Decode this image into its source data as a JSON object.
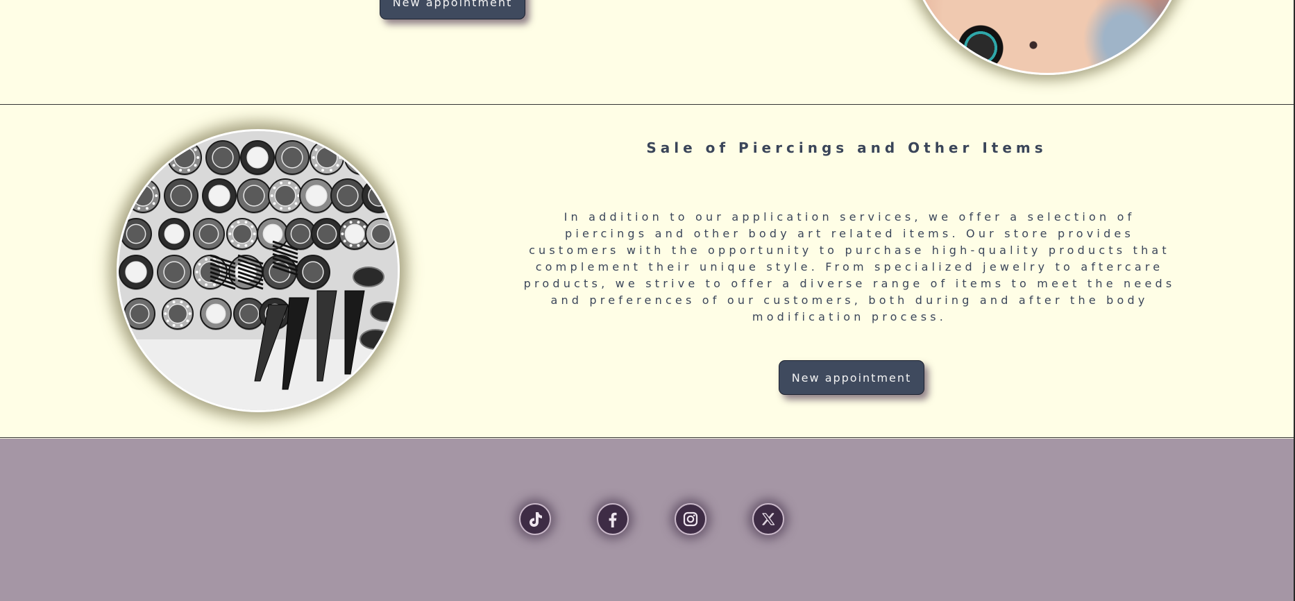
{
  "top_section": {
    "appointment_button_label": "New appointment"
  },
  "shop_section": {
    "title": "Sale of Piercings and Other Items",
    "description": "In addition to our application services, we offer a selection of piercings and other body art related items. Our store provides customers with the opportunity to purchase high-quality products that complement their unique style. From specialized jewelry to aftercare products, we strive to offer a diverse range of items to meet the needs and preferences of our customers, both during and after the body modification process.",
    "appointment_button_label": "New appointment"
  },
  "footer": {
    "social_links": [
      {
        "icon": "tiktok-icon"
      },
      {
        "icon": "facebook-icon"
      },
      {
        "icon": "instagram-icon"
      },
      {
        "icon": "x-twitter-icon"
      }
    ]
  },
  "colors": {
    "page_background": "#fffee6",
    "text": "#3a4559",
    "button_background": "#3f4a5e",
    "footer_background": "#a596a5",
    "social_icon_background": "#3e2c45"
  }
}
